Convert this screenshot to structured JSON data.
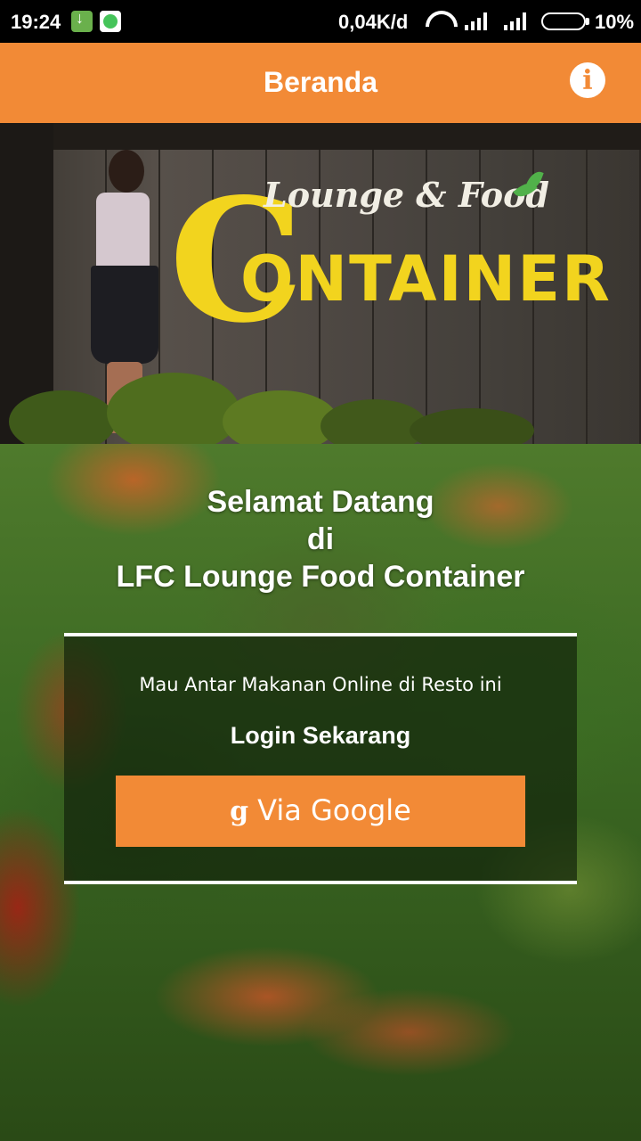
{
  "status_bar": {
    "time": "19:24",
    "network_speed": "0,04K/d",
    "battery": "10%",
    "icons": [
      "download-icon",
      "whatsapp-icon",
      "wifi-icon",
      "signal-icon",
      "signal-icon",
      "battery-icon"
    ]
  },
  "app_bar": {
    "title": "Beranda",
    "info_icon": "info-icon",
    "info_glyph": "i",
    "color": "#f28a36"
  },
  "banner": {
    "logo_top": "Lounge & Food",
    "logo_main_initial": "C",
    "logo_main_rest": "ONTAINER"
  },
  "welcome": {
    "line1": "Selamat Datang",
    "line2": "di",
    "line3": "LFC Lounge Food Container"
  },
  "login": {
    "subtitle": "Mau Antar Makanan Online di Resto ini",
    "title": "Login Sekarang",
    "google_icon": "google-icon",
    "google_glyph": "g",
    "google_button_label": "Via Google"
  }
}
